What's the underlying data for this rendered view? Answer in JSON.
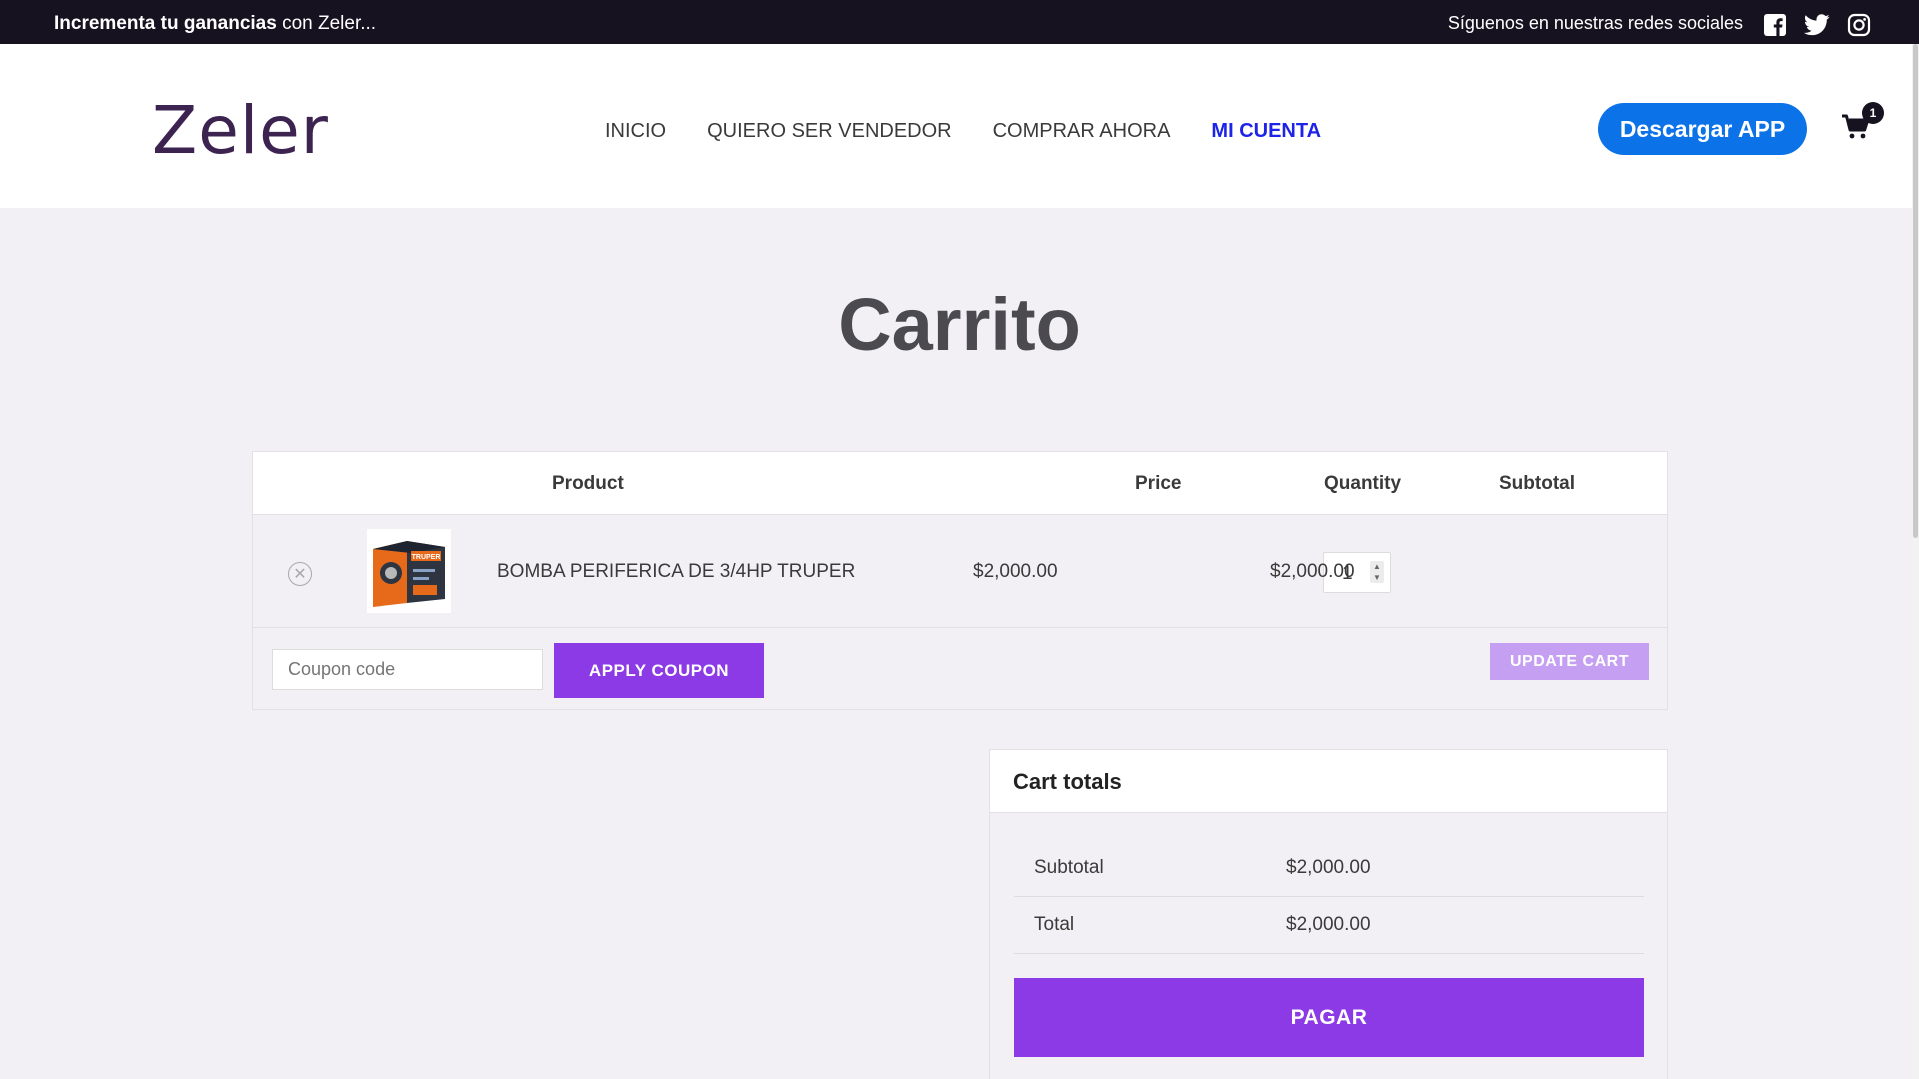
{
  "topbar": {
    "promo_bold": "Incrementa tu ganancias",
    "promo_rest": " con Zeler...",
    "social_text": "Síguenos en nuestras redes sociales",
    "social_icons": [
      "facebook-icon",
      "twitter-icon",
      "instagram-icon"
    ]
  },
  "header": {
    "logo": "Zeler",
    "nav": [
      "INICIO",
      "QUIERO SER VENDEDOR",
      "COMPRAR AHORA",
      "MI CUENTA"
    ],
    "active_nav": "MI CUENTA",
    "app_button": "Descargar APP",
    "cart_count": "1"
  },
  "page": {
    "title": "Carrito"
  },
  "cart": {
    "headers": {
      "product": "Product",
      "price": "Price",
      "quantity": "Quantity",
      "subtotal": "Subtotal"
    },
    "item": {
      "name": "BOMBA PERIFERICA DE 3/4HP TRUPER",
      "price": "$2,000.00",
      "quantity": "1",
      "subtotal": "$2,000.00",
      "image_brand": "TRUPER"
    },
    "coupon_placeholder": "Coupon code",
    "apply_button": "APPLY COUPON",
    "update_button": "UPDATE CART"
  },
  "totals": {
    "title": "Cart totals",
    "subtotal_label": "Subtotal",
    "subtotal_value": "$2,000.00",
    "total_label": "Total",
    "total_value": "$2,000.00",
    "pay_button": "PAGAR"
  },
  "colors": {
    "topbar": "#16121f",
    "accent_purple": "#8b3ae6",
    "update_purple": "#c5a0f2",
    "app_blue": "#0b72e8",
    "active_nav": "#1d24e8"
  }
}
